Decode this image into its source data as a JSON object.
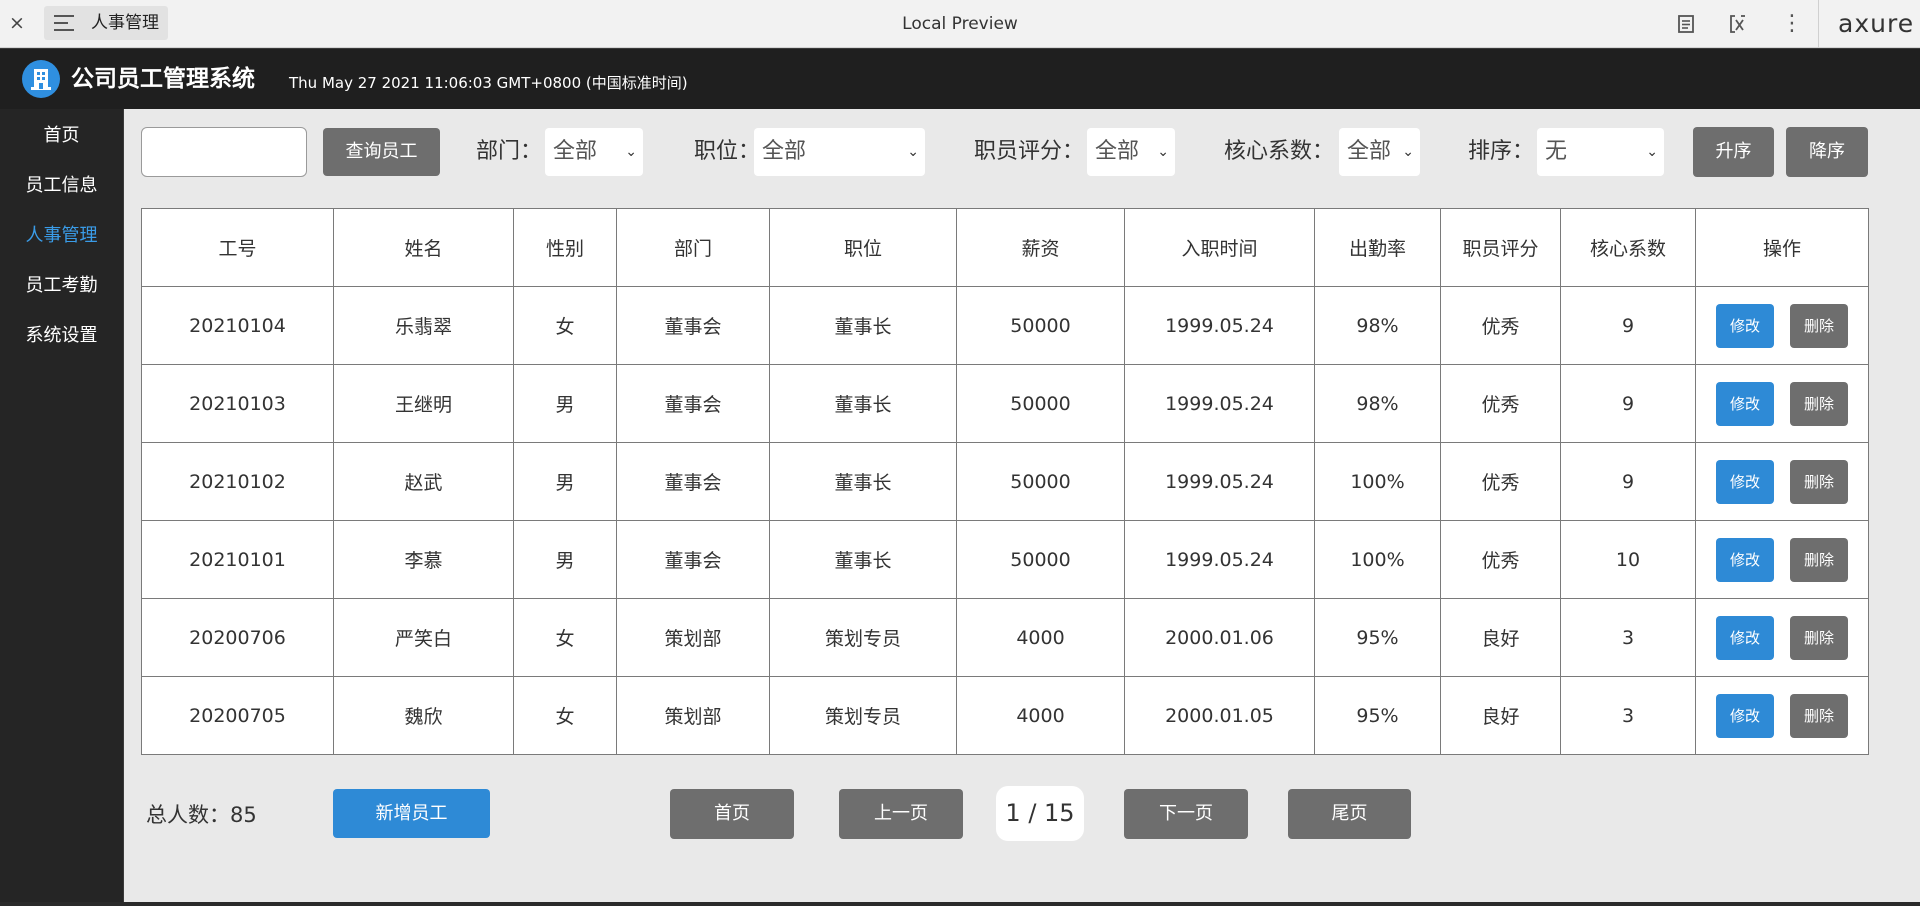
{
  "preview_bar": {
    "close_glyph": "×",
    "tab_label": "人事管理",
    "title": "Local Preview",
    "more_glyph": "⋮",
    "logo_text": "axure"
  },
  "app": {
    "title": "公司员工管理系统",
    "datetime": "Thu May 27 2021 11:06:03 GMT+0800 (中国标准时间)"
  },
  "sidebar": {
    "items": [
      {
        "label": "首页",
        "active": false
      },
      {
        "label": "员工信息",
        "active": false
      },
      {
        "label": "人事管理",
        "active": true
      },
      {
        "label": "员工考勤",
        "active": false
      },
      {
        "label": "系统设置",
        "active": false
      }
    ]
  },
  "filters": {
    "search_value": "",
    "search_button": "查询员工",
    "department_label": "部门：",
    "department_value": "全部",
    "position_label": "职位：",
    "position_value": "全部",
    "rating_label": "职员评分：",
    "rating_value": "全部",
    "core_label": "核心系数：",
    "core_value": "全部",
    "sort_label": "排序：",
    "sort_value": "无",
    "asc_button": "升序",
    "desc_button": "降序"
  },
  "table": {
    "headers": [
      "工号",
      "姓名",
      "性别",
      "部门",
      "职位",
      "薪资",
      "入职时间",
      "出勤率",
      "职员评分",
      "核心系数",
      "操作"
    ],
    "edit_label": "修改",
    "delete_label": "删除",
    "rows": [
      [
        "20210104",
        "乐翡翠",
        "女",
        "董事会",
        "董事长",
        "50000",
        "1999.05.24",
        "98%",
        "优秀",
        "9"
      ],
      [
        "20210103",
        "王继明",
        "男",
        "董事会",
        "董事长",
        "50000",
        "1999.05.24",
        "98%",
        "优秀",
        "9"
      ],
      [
        "20210102",
        "赵武",
        "男",
        "董事会",
        "董事长",
        "50000",
        "1999.05.24",
        "100%",
        "优秀",
        "9"
      ],
      [
        "20210101",
        "李慕",
        "男",
        "董事会",
        "董事长",
        "50000",
        "1999.05.24",
        "100%",
        "优秀",
        "10"
      ],
      [
        "20200706",
        "严笑白",
        "女",
        "策划部",
        "策划专员",
        "4000",
        "2000.01.06",
        "95%",
        "良好",
        "3"
      ],
      [
        "20200705",
        "魏欣",
        "女",
        "策划部",
        "策划专员",
        "4000",
        "2000.01.05",
        "95%",
        "良好",
        "3"
      ]
    ]
  },
  "footer": {
    "total_text": "总人数：85",
    "add_button": "新增员工",
    "first_page": "首页",
    "prev_page": "上一页",
    "page_indicator": "1 / 15",
    "next_page": "下一页",
    "last_page": "尾页"
  },
  "colors": {
    "accent": "#2e8ad6",
    "active_nav": "#3a9ce8",
    "header_bg": "#1f1f1f",
    "sidebar_bg": "#252525",
    "content_bg": "#e9e9e9",
    "gray_button": "#6e6e6e"
  }
}
